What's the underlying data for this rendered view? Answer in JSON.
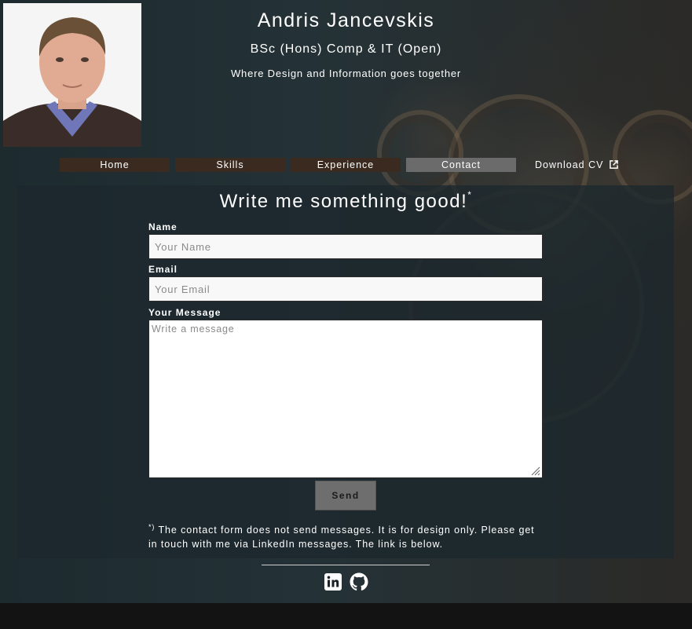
{
  "header": {
    "name": "Andris Jancevskis",
    "degree": "BSc (Hons) Comp & IT (Open)",
    "tagline": "Where Design and Information goes together"
  },
  "nav": {
    "items": [
      {
        "label": "Home"
      },
      {
        "label": "Skills"
      },
      {
        "label": "Experience"
      },
      {
        "label": "Contact",
        "active": true
      },
      {
        "label": "Download CV"
      }
    ]
  },
  "contact": {
    "heading": "Write me something good!",
    "heading_mark": "*",
    "name_label": "Name",
    "name_placeholder": "Your Name",
    "email_label": "Email",
    "email_placeholder": "Your Email",
    "message_label": "Your Message",
    "message_placeholder": "Write a message",
    "send_label": "Send",
    "note_mark": "*)",
    "note_text": " The contact form does not send messages. It is for design only. Please get in touch with me via LinkedIn messages. The link is below."
  },
  "social": {
    "icons": [
      "linkedin-icon",
      "github-icon"
    ]
  },
  "colors": {
    "nav_background": "#3b2a1f",
    "nav_active": "#6b6b6b",
    "panel": "#1c282d",
    "send_button": "#6e6e6e"
  }
}
